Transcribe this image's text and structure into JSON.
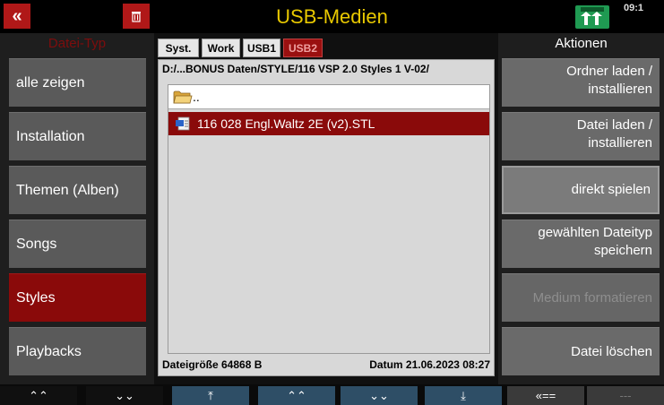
{
  "window": {
    "title": "USB-Medien",
    "clock": "09:1",
    "back_label": "«"
  },
  "left_panel": {
    "header": "Datei-Typ",
    "items": [
      {
        "label": "alle zeigen",
        "active": false
      },
      {
        "label": "Installation",
        "active": false
      },
      {
        "label": "Themen (Alben)",
        "active": false
      },
      {
        "label": "Songs",
        "active": false
      },
      {
        "label": "Styles",
        "active": true
      },
      {
        "label": "Playbacks",
        "active": false
      }
    ]
  },
  "tabs": [
    {
      "label": "Syst.",
      "active": false
    },
    {
      "label": "Work",
      "active": false
    },
    {
      "label": "USB1",
      "active": false
    },
    {
      "label": "USB2",
      "active": true
    }
  ],
  "browser": {
    "path": "D:/...BONUS Daten/STYLE/116 VSP 2.0 Styles 1 V-02/",
    "parent_label": "..",
    "files": [
      {
        "name": "116 028 Engl.Waltz 2E (v2).STL",
        "selected": true
      }
    ],
    "status": {
      "size_label": "Dateigröße 64868 B",
      "date_label": "Datum 21.06.2023   08:27"
    }
  },
  "right_panel": {
    "header": "Aktionen",
    "actions": [
      {
        "line1": "Ordner laden  /",
        "line2": "installieren",
        "state": "normal"
      },
      {
        "line1": "Datei laden  /",
        "line2": "installieren",
        "state": "normal"
      },
      {
        "line1": "direkt  spielen",
        "line2": "",
        "state": "highlight"
      },
      {
        "line1": "gewählten  Dateityp",
        "line2": "speichern",
        "state": "normal"
      },
      {
        "line1": "Medium  formatieren",
        "line2": "",
        "state": "disabled"
      },
      {
        "line1": "Datei  löschen",
        "line2": "",
        "state": "normal"
      }
    ]
  },
  "bottom_bar": {
    "buttons": [
      {
        "label": "⌃⌃",
        "style": "dark"
      },
      {
        "label": "⌄⌄",
        "style": "dark"
      },
      {
        "label": "⤒",
        "style": "blue"
      },
      {
        "label": "⌃⌃",
        "style": "blue"
      },
      {
        "label": "⌄⌄",
        "style": "blue"
      },
      {
        "label": "⤓",
        "style": "blue"
      },
      {
        "label": "«==",
        "style": "grey"
      },
      {
        "label": "---",
        "style": "grey"
      }
    ]
  },
  "colors": {
    "title": "#e8c800",
    "accent_red": "#8a0a0a",
    "header_red": "#7e0d0d",
    "button_grey": "#5a5a5a",
    "nav_blue": "#2e4e66"
  }
}
